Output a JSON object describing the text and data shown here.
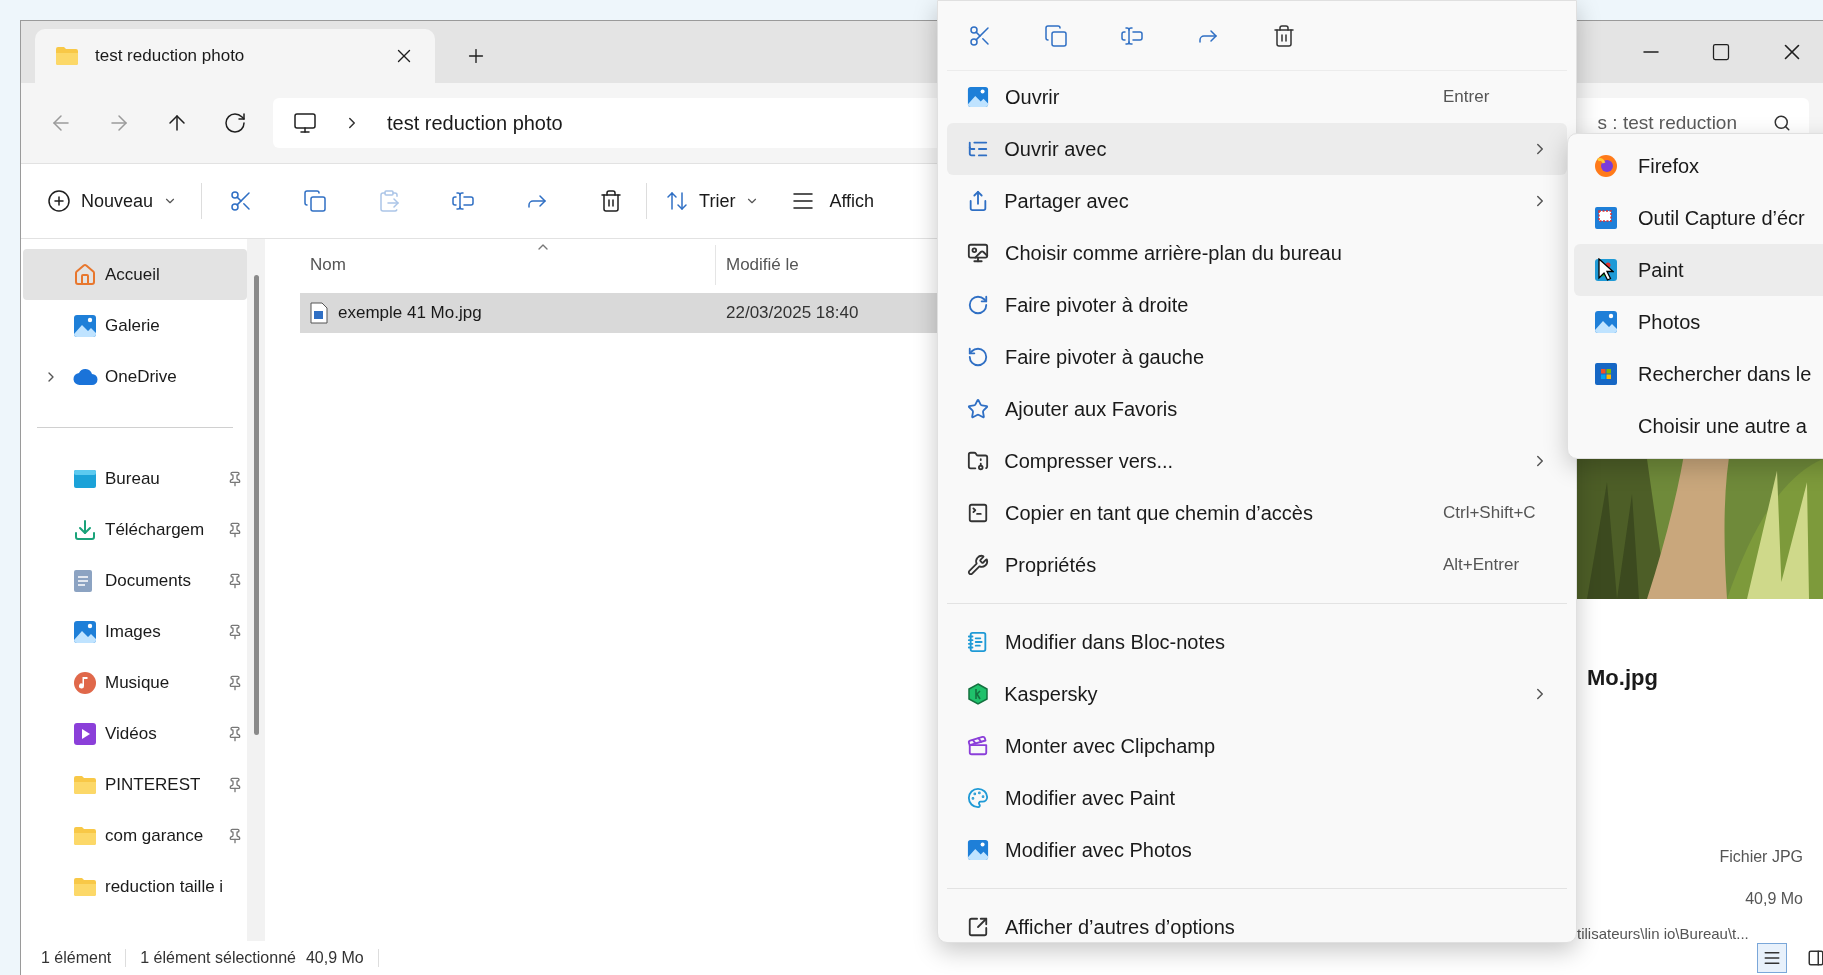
{
  "tab": {
    "title": "test reduction photo"
  },
  "address": {
    "path": "test reduction photo"
  },
  "search": {
    "placeholder": "s : test reduction"
  },
  "toolbar": {
    "new_label": "Nouveau",
    "sort_label": "Trier",
    "view_label": "Affich"
  },
  "sidebar": {
    "items": [
      {
        "kind": "item",
        "label": "Accueil",
        "selected": true,
        "pinned": false
      },
      {
        "kind": "item",
        "label": "Galerie",
        "selected": false,
        "pinned": false
      },
      {
        "kind": "expandable",
        "label": "OneDrive",
        "selected": false,
        "pinned": false,
        "expanded": false
      },
      {
        "kind": "separator"
      },
      {
        "kind": "item",
        "label": "Bureau",
        "selected": false,
        "pinned": true
      },
      {
        "kind": "item",
        "label": "Téléchargem",
        "selected": false,
        "pinned": true
      },
      {
        "kind": "item",
        "label": "Documents",
        "selected": false,
        "pinned": true
      },
      {
        "kind": "item",
        "label": "Images",
        "selected": false,
        "pinned": true
      },
      {
        "kind": "item",
        "label": "Musique",
        "selected": false,
        "pinned": true
      },
      {
        "kind": "item",
        "label": "Vidéos",
        "selected": false,
        "pinned": true
      },
      {
        "kind": "item",
        "label": "PINTEREST",
        "selected": false,
        "pinned": true
      },
      {
        "kind": "item",
        "label": "com garance",
        "selected": false,
        "pinned": true
      },
      {
        "kind": "item",
        "label": "reduction taille i",
        "selected": false,
        "pinned": false
      }
    ]
  },
  "file_list": {
    "columns": [
      "Nom",
      "Modifié le"
    ],
    "rows": [
      {
        "name": "exemple 41 Mo.jpg",
        "modified": "22/03/2025 18:40",
        "selected": true
      }
    ]
  },
  "details": {
    "title": "Mo.jpg",
    "type": "Fichier JPG",
    "size": "40,9 Mo",
    "path": "tilisateurs\\lin io\\Bureau\\t..."
  },
  "status_bar": [
    "1 élément",
    "1 élément sélectionné",
    "40,9 Mo"
  ],
  "context_menu": {
    "items": [
      {
        "kind": "item",
        "label": "Ouvrir",
        "shortcut": "Entrer",
        "has_submenu": false,
        "selected": false
      },
      {
        "kind": "item",
        "label": "Ouvrir avec",
        "has_submenu": true,
        "selected": true
      },
      {
        "kind": "item",
        "label": "Partager avec",
        "has_submenu": true,
        "selected": false
      },
      {
        "kind": "item",
        "label": "Choisir comme arrière-plan du bureau",
        "has_submenu": false,
        "selected": false
      },
      {
        "kind": "item",
        "label": "Faire pivoter à droite",
        "has_submenu": false,
        "selected": false
      },
      {
        "kind": "item",
        "label": "Faire pivoter à gauche",
        "has_submenu": false,
        "selected": false
      },
      {
        "kind": "item",
        "label": "Ajouter aux Favoris",
        "has_submenu": false,
        "selected": false
      },
      {
        "kind": "item",
        "label": "Compresser vers...",
        "has_submenu": true,
        "selected": false
      },
      {
        "kind": "item",
        "label": "Copier en tant que chemin d’accès",
        "shortcut": "Ctrl+Shift+C",
        "has_submenu": false,
        "selected": false
      },
      {
        "kind": "item",
        "label": "Propriétés",
        "shortcut": "Alt+Entrer",
        "has_submenu": false,
        "selected": false
      },
      {
        "kind": "separator"
      },
      {
        "kind": "item",
        "label": "Modifier dans Bloc-notes",
        "has_submenu": false,
        "selected": false
      },
      {
        "kind": "item",
        "label": "Kaspersky",
        "has_submenu": true,
        "selected": false
      },
      {
        "kind": "item",
        "label": "Monter avec Clipchamp",
        "has_submenu": false,
        "selected": false
      },
      {
        "kind": "item",
        "label": "Modifier avec Paint",
        "has_submenu": false,
        "selected": false
      },
      {
        "kind": "item",
        "label": "Modifier avec Photos",
        "has_submenu": false,
        "selected": false
      },
      {
        "kind": "separator"
      },
      {
        "kind": "item",
        "label": "Afficher d’autres d’options",
        "has_submenu": false,
        "selected": false
      }
    ]
  },
  "submenu": {
    "items": [
      {
        "label": "Firefox",
        "selected": false
      },
      {
        "label": "Outil Capture d’écr",
        "selected": false
      },
      {
        "label": "Paint",
        "selected": true
      },
      {
        "label": "Photos",
        "selected": false
      },
      {
        "label": "Rechercher dans le",
        "selected": false
      },
      {
        "label": "Choisir une autre a",
        "selected": false
      }
    ]
  }
}
